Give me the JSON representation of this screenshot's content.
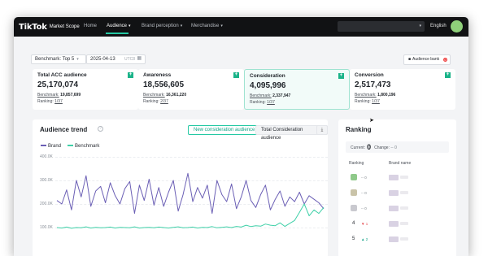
{
  "nav": {
    "logo": "TikTok",
    "product": "Market Scope",
    "items": [
      {
        "label": "Home",
        "active": false,
        "dropdown": false
      },
      {
        "label": "Audience",
        "active": true,
        "dropdown": true
      },
      {
        "label": "Brand perception",
        "active": false,
        "dropdown": true
      },
      {
        "label": "Merchandise",
        "active": false,
        "dropdown": true
      }
    ],
    "language": "English",
    "accent": "#25c9a4"
  },
  "filters": {
    "benchmark": "Benchmark: Top 5",
    "date": "2025-04-13",
    "timezone": "UTC8",
    "audience_bank": "Audience bank",
    "audience_bank_badge": "0"
  },
  "kpis": [
    {
      "title": "Total ACC audience",
      "value": "25,170,074",
      "benchmark_label": "Benchmark:",
      "benchmark": "19,857,699",
      "ranking_label": "Ranking:",
      "ranking": "1/37",
      "highlight": false
    },
    {
      "title": "Awareness",
      "value": "18,556,605",
      "benchmark_label": "Benchmark:",
      "benchmark": "16,361,220",
      "ranking_label": "Ranking:",
      "ranking": "2/37",
      "highlight": false
    },
    {
      "title": "Consideration",
      "value": "4,095,996",
      "benchmark_label": "Benchmark:",
      "benchmark": "2,337,947",
      "ranking_label": "Ranking:",
      "ranking": "1/37",
      "highlight": true
    },
    {
      "title": "Conversion",
      "value": "2,517,473",
      "benchmark_label": "Benchmark:",
      "benchmark": "1,800,196",
      "ranking_label": "Ranking:",
      "ranking": "1/37",
      "highlight": false
    }
  ],
  "trend": {
    "title": "Audience trend",
    "toggles": [
      "New consideration audience",
      "Total Consideration audience"
    ],
    "active_toggle": 0,
    "legend": [
      {
        "name": "Brand",
        "color": "#6b5fb5"
      },
      {
        "name": "Benchmark",
        "color": "#3fd0a8"
      }
    ],
    "yticks": [
      "400.0K",
      "300.0K",
      "200.0K",
      "100.0K"
    ]
  },
  "chart_data": {
    "type": "line",
    "title": "Audience trend",
    "xlabel": "",
    "ylabel": "",
    "ylim": [
      100000,
      400000
    ],
    "grid": true,
    "legend_position": "top-left",
    "series": [
      {
        "name": "Brand",
        "color": "#6b5fb5",
        "values": [
          215000,
          200000,
          260000,
          175000,
          300000,
          230000,
          320000,
          190000,
          255000,
          275000,
          205000,
          290000,
          235000,
          200000,
          265000,
          295000,
          160000,
          280000,
          215000,
          305000,
          195000,
          270000,
          190000,
          250000,
          300000,
          170000,
          240000,
          330000,
          210000,
          270000,
          225000,
          280000,
          160000,
          300000,
          240000,
          210000,
          285000,
          180000,
          230000,
          300000,
          215000,
          185000,
          240000,
          280000,
          175000,
          220000,
          255000,
          190000,
          230000,
          210000,
          250000,
          200000,
          235000,
          220000,
          205000,
          180000
        ]
      },
      {
        "name": "Benchmark",
        "color": "#3fd0a8",
        "values": [
          100000,
          98000,
          102000,
          97000,
          100000,
          99000,
          103000,
          98000,
          101000,
          99000,
          100000,
          102000,
          98000,
          101000,
          100000,
          99000,
          103000,
          98000,
          100000,
          101000,
          99000,
          102000,
          100000,
          98000,
          101000,
          103000,
          99000,
          100000,
          102000,
          98000,
          101000,
          100000,
          104000,
          99000,
          101000,
          103000,
          100000,
          105000,
          102000,
          110000,
          104000,
          108000,
          106000,
          115000,
          110000,
          108000,
          120000,
          105000,
          118000,
          130000,
          165000,
          200000,
          150000,
          175000,
          160000,
          185000
        ]
      }
    ]
  },
  "ranking": {
    "title": "Ranking",
    "current_label": "Current:",
    "current_value": "0",
    "change_label": "Change:",
    "change_value": "-- 0",
    "col_ranking": "Ranking",
    "col_brand": "Brand name",
    "rows": [
      {
        "rank": "",
        "medal": "#8fc98a",
        "delta": "-- 0",
        "dir": "flat"
      },
      {
        "rank": "",
        "medal": "#c9c3a8",
        "delta": "-- 0",
        "dir": "flat"
      },
      {
        "rank": "",
        "medal": "#c9c9cf",
        "delta": "-- 0",
        "dir": "flat"
      },
      {
        "rank": "4",
        "medal": "",
        "delta": "▼ 1",
        "dir": "down"
      },
      {
        "rank": "5",
        "medal": "",
        "delta": "▲ 2",
        "dir": "up"
      }
    ]
  }
}
